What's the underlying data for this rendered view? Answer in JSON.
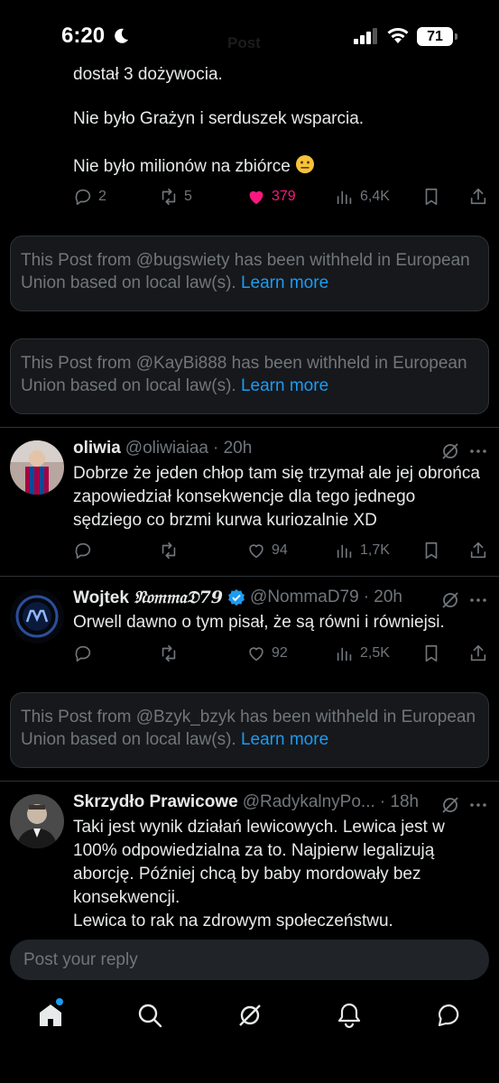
{
  "status": {
    "time": "6:20",
    "battery": "71",
    "ghost_title": "Post"
  },
  "first_post": {
    "lines": [
      "dostał 3 dożywocia.",
      "Nie było Grażyn i serduszek wsparcia.",
      "Nie było milionów na zbiórce"
    ],
    "replies": "2",
    "reposts": "5",
    "likes": "379",
    "views": "6,4K"
  },
  "withheld": [
    {
      "text": "This Post from @bugswiety has been withheld in European Union based on local law(s).",
      "link": "Learn more"
    },
    {
      "text": "This Post from @KayBi888 has been withheld in European Union based on local law(s).",
      "link": "Learn more"
    },
    {
      "text": "This Post from @Bzyk_bzyk has been withheld in European Union based on local law(s).",
      "link": "Learn more"
    }
  ],
  "posts": [
    {
      "name": "oliwia",
      "handle": "@oliwiaiaa",
      "time": "· 20h",
      "text": "Dobrze że jeden chłop tam się trzymał ale jej obrońca zapowiedział konsekwencje dla tego jednego sędziego co brzmi kurwa kuriozalnie XD",
      "likes": "94",
      "views": "1,7K"
    },
    {
      "name": "Wojtek",
      "name_suffix": "𝔑𝔬𝔪𝔪𝔞𝔇79",
      "handle": "@NommaD79",
      "time": "· 20h",
      "text": "Orwell dawno o tym pisał, że są równi i równiejsi.",
      "likes": "92",
      "views": "2,5K"
    },
    {
      "name": "Skrzydło Prawicowe",
      "handle": "@RadykalnyPo...",
      "time": "· 18h",
      "text": "Taki jest wynik działań lewicowych. Lewica jest w 100% odpowiedzialna za to. Najpierw legalizują aborcję. Później chcą by baby mordowały bez konsekwencji.\nLewica to rak na zdrowym społeczeństwu."
    }
  ],
  "reply_placeholder": "Post your reply",
  "colors": {
    "accent": "#1d9bf0",
    "like": "#f91880",
    "muted": "#71767b",
    "verified": "#1d9bf0"
  }
}
